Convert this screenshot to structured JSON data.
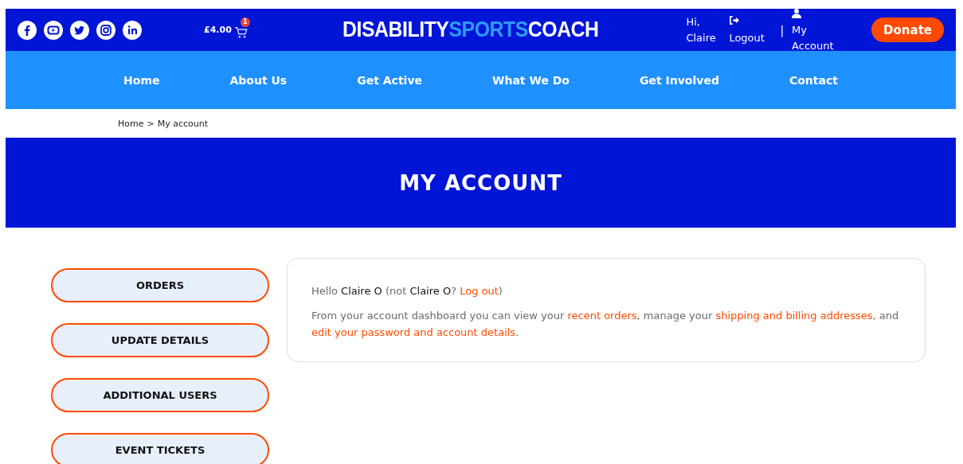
{
  "header": {
    "social": [
      {
        "kind": "facebook"
      },
      {
        "kind": "youtube"
      },
      {
        "kind": "twitter"
      },
      {
        "kind": "instagram"
      },
      {
        "kind": "linkedin"
      }
    ],
    "cart": {
      "total": "£4.00",
      "count": "1"
    },
    "logo": [
      {
        "text": "DISABILITY",
        "kind": "plain"
      },
      {
        "text": "SPORTS",
        "kind": "accent"
      },
      {
        "text": "COACH",
        "kind": "plain"
      }
    ],
    "greeting": "Hi, Claire",
    "logout": "Logout",
    "separator": "|",
    "account": "My Account",
    "donate": "Donate"
  },
  "nav": [
    "Home",
    "About Us",
    "Get Active",
    "What We Do",
    "Get Involved",
    "Contact"
  ],
  "breadcrumb": {
    "link": "Home",
    "separator": ">",
    "current": "My account"
  },
  "page_title": "MY ACCOUNT",
  "sidebar": [
    "ORDERS",
    "UPDATE DETAILS",
    "ADDITIONAL USERS",
    "EVENT TICKETS"
  ],
  "dashboard": {
    "paragraphs": [
      [
        {
          "kind": "text",
          "text": "Hello "
        },
        {
          "kind": "bold",
          "text": "Claire O"
        },
        {
          "kind": "text",
          "text": " (not "
        },
        {
          "kind": "bold",
          "text": "Claire O"
        },
        {
          "kind": "text",
          "text": "? "
        },
        {
          "kind": "link",
          "text": "Log out"
        },
        {
          "kind": "text",
          "text": ")"
        }
      ],
      [
        {
          "kind": "text",
          "text": "From your account dashboard you can view your "
        },
        {
          "kind": "link",
          "text": "recent orders"
        },
        {
          "kind": "text",
          "text": ", manage your "
        },
        {
          "kind": "link",
          "text": "shipping and billing addresses"
        },
        {
          "kind": "text",
          "text": ", and "
        },
        {
          "kind": "link",
          "text": "edit your password and account details"
        },
        {
          "kind": "text",
          "text": "."
        }
      ]
    ]
  }
}
